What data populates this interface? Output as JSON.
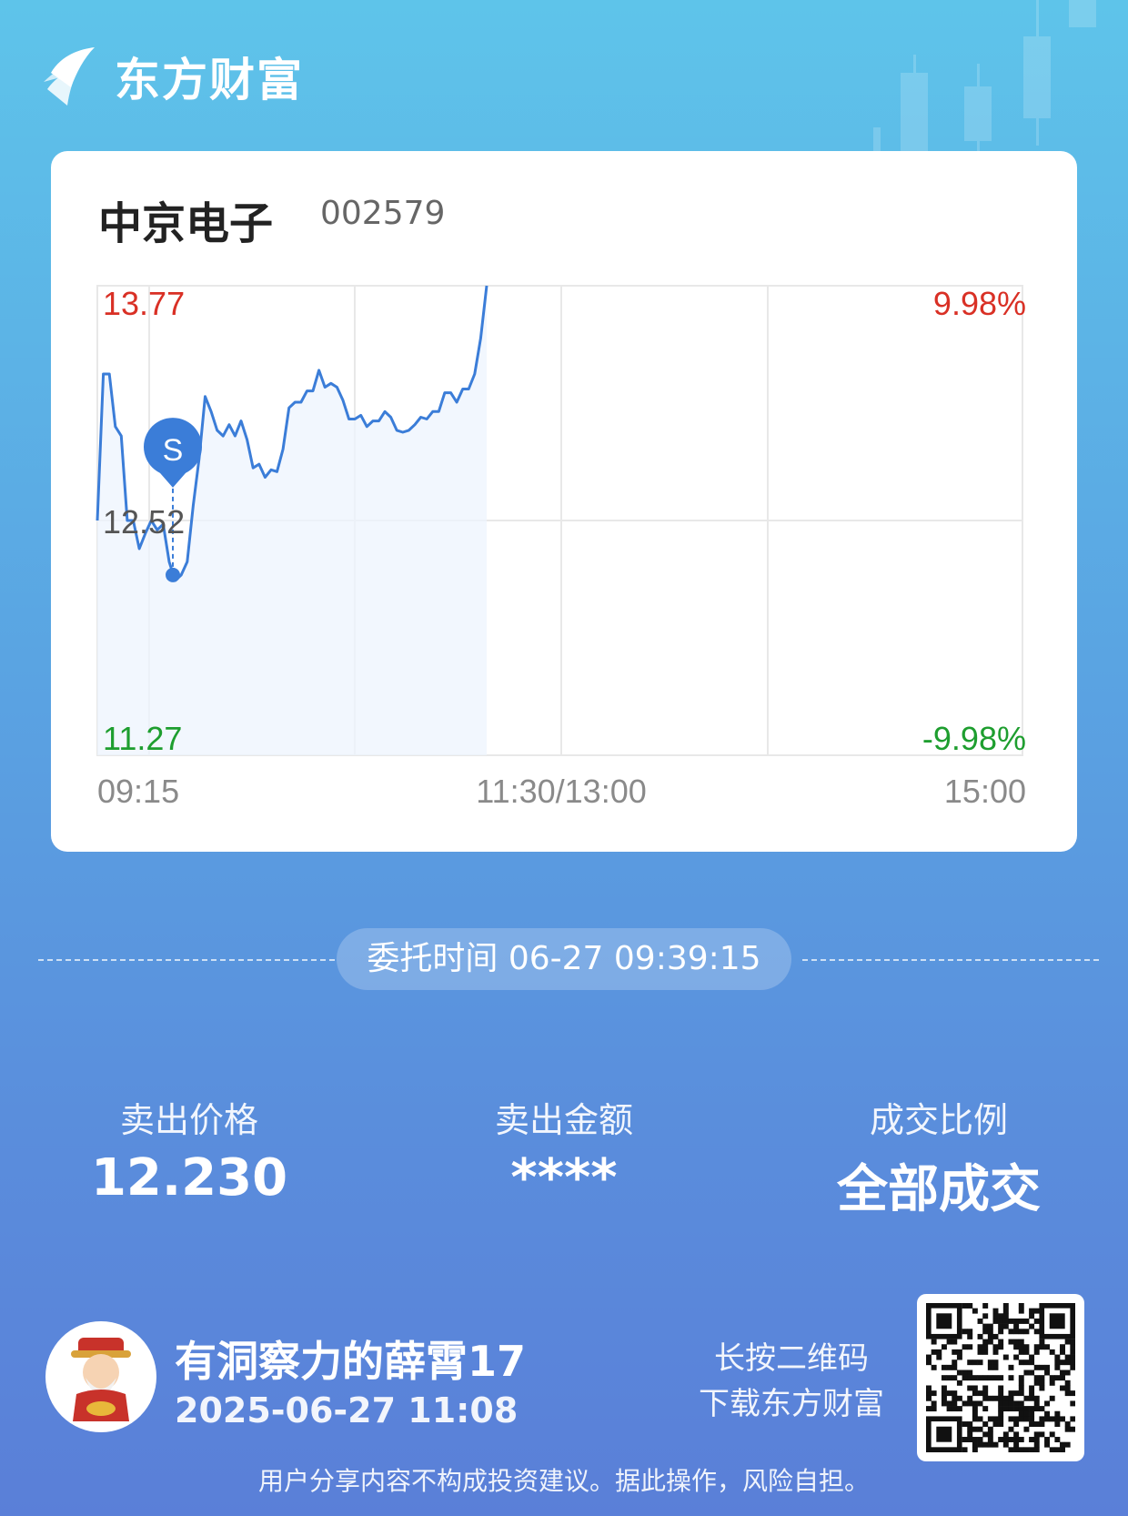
{
  "brand": {
    "name": "东方财富"
  },
  "stock": {
    "name": "中京电子",
    "code": "002579"
  },
  "chart_data": {
    "type": "line",
    "x_ticks": [
      "09:15",
      "11:30/13:00",
      "15:00"
    ],
    "y_left_ticks": {
      "top": "13.77",
      "mid": "12.52",
      "bottom": "11.27"
    },
    "y_right_ticks": {
      "top": "9.98%",
      "bottom": "-9.98%"
    },
    "ylim": [
      11.27,
      13.77
    ],
    "marker": {
      "label": "S",
      "price": 12.23
    },
    "series": [
      {
        "values": [
          12.52,
          13.3,
          13.3,
          13.02,
          12.97,
          12.52,
          12.52,
          12.37,
          12.45,
          12.52,
          12.47,
          12.5,
          12.3,
          12.2,
          12.23,
          12.3,
          12.6,
          12.85,
          13.18,
          13.1,
          13.0,
          12.97,
          13.03,
          12.97,
          13.05,
          12.95,
          12.8,
          12.82,
          12.75,
          12.79,
          12.78,
          12.9,
          13.12,
          13.15,
          13.15,
          13.21,
          13.21,
          13.32,
          13.23,
          13.25,
          13.23,
          13.16,
          13.06,
          13.06,
          13.08,
          13.02,
          13.05,
          13.05,
          13.1,
          13.07,
          13.0,
          12.99,
          13.0,
          13.03,
          13.07,
          13.06,
          13.1,
          13.1,
          13.2,
          13.2,
          13.15,
          13.22,
          13.22,
          13.3,
          13.49,
          13.77
        ]
      }
    ]
  },
  "order": {
    "time_text": "委托时间 06-27 09:39:15"
  },
  "stats": [
    {
      "label": "卖出价格",
      "value": "12.230"
    },
    {
      "label": "卖出金额",
      "value": "****"
    },
    {
      "label": "成交比例",
      "value": "全部成交"
    }
  ],
  "user": {
    "name": "有洞察力的薛霄17",
    "time": "2025-06-27 11:08"
  },
  "qr": {
    "hint_line1": "长按二维码",
    "hint_line2": "下载东方财富"
  },
  "disclaimer": "用户分享内容不构成投资建议。据此操作，风险自担。",
  "colors": {
    "line": "#3b7dd8",
    "up": "#d93025",
    "down": "#1e9e2f"
  }
}
